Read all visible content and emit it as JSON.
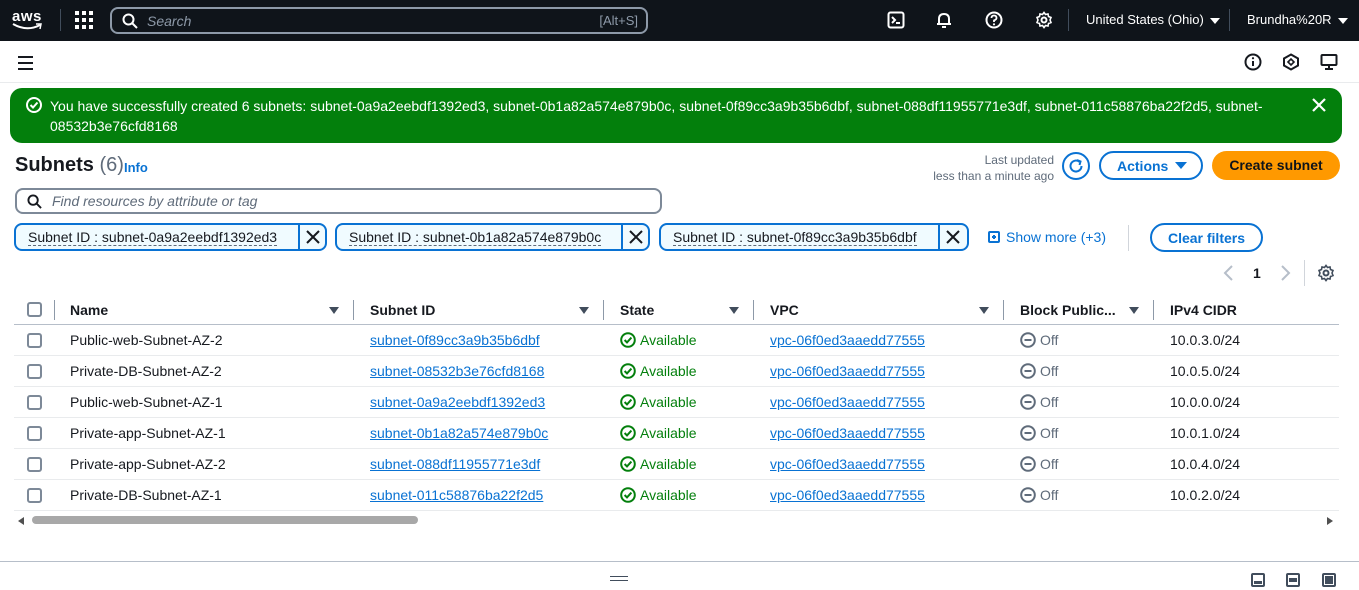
{
  "topnav": {
    "logo_text": "aws",
    "search_placeholder": "Search",
    "search_shortcut": "[Alt+S]",
    "region": "United States (Ohio)",
    "user": "Brundha%20R",
    "icons": [
      "services-grid-icon",
      "cloudshell-icon",
      "bell-icon",
      "help-icon",
      "gear-icon"
    ]
  },
  "flash": {
    "message": "You have successfully created 6 subnets: subnet-0a9a2eebdf1392ed3, subnet-0b1a82a574e879b0c, subnet-0f89cc3a9b35b6dbf, subnet-088df11955771e3df, subnet-011c58876ba22f2d5, subnet-08532b3e76cfd8168",
    "type": "success",
    "color": "#037f0c"
  },
  "header": {
    "title": "Subnets",
    "count": "(6)",
    "info": "Info",
    "last_updated_label": "Last updated",
    "last_updated_value": "less than a minute ago",
    "actions_label": "Actions",
    "create_label": "Create subnet"
  },
  "filter": {
    "placeholder": "Find resources by attribute or tag",
    "tokens": [
      "Subnet ID : subnet-0a9a2eebdf1392ed3",
      "Subnet ID : subnet-0b1a82a574e879b0c",
      "Subnet ID : subnet-0f89cc3a9b35b6dbf"
    ],
    "show_more": "Show more (+3)",
    "clear_label": "Clear filters"
  },
  "pagination": {
    "current_page": "1"
  },
  "table": {
    "columns": [
      "Name",
      "Subnet ID",
      "State",
      "VPC",
      "Block Public...",
      "IPv4 CIDR"
    ],
    "rows": [
      {
        "name": "Public-web-Subnet-AZ-2",
        "subnet_id": "subnet-0f89cc3a9b35b6dbf",
        "state": "Available",
        "vpc": "vpc-06f0ed3aaedd77555",
        "block": "Off",
        "cidr": "10.0.3.0/24"
      },
      {
        "name": "Private-DB-Subnet-AZ-2",
        "subnet_id": "subnet-08532b3e76cfd8168",
        "state": "Available",
        "vpc": "vpc-06f0ed3aaedd77555",
        "block": "Off",
        "cidr": "10.0.5.0/24"
      },
      {
        "name": "Public-web-Subnet-AZ-1",
        "subnet_id": "subnet-0a9a2eebdf1392ed3",
        "state": "Available",
        "vpc": "vpc-06f0ed3aaedd77555",
        "block": "Off",
        "cidr": "10.0.0.0/24"
      },
      {
        "name": "Private-app-Subnet-AZ-1",
        "subnet_id": "subnet-0b1a82a574e879b0c",
        "state": "Available",
        "vpc": "vpc-06f0ed3aaedd77555",
        "block": "Off",
        "cidr": "10.0.1.0/24"
      },
      {
        "name": "Private-app-Subnet-AZ-2",
        "subnet_id": "subnet-088df11955771e3df",
        "state": "Available",
        "vpc": "vpc-06f0ed3aaedd77555",
        "block": "Off",
        "cidr": "10.0.4.0/24"
      },
      {
        "name": "Private-DB-Subnet-AZ-1",
        "subnet_id": "subnet-011c58876ba22f2d5",
        "state": "Available",
        "vpc": "vpc-06f0ed3aaedd77555",
        "block": "Off",
        "cidr": "10.0.2.0/24"
      }
    ]
  },
  "colors": {
    "nav_bg": "#0f141a",
    "link": "#0972d3",
    "primary_button": "#ff9900",
    "success": "#037f0c"
  }
}
